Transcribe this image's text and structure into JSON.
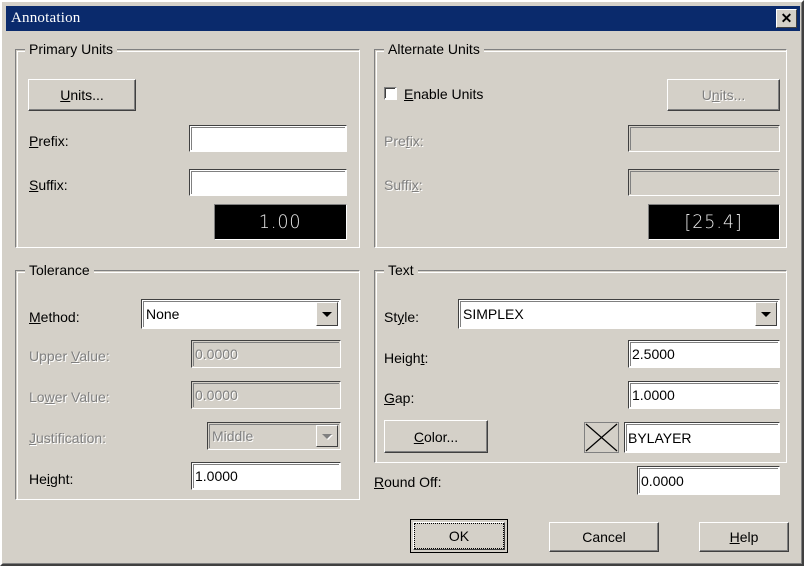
{
  "window": {
    "title": "Annotation",
    "close_label": "✕",
    "close_icon": "close-icon"
  },
  "primary_units": {
    "group_title": "Primary Units",
    "units_button": {
      "label": "Units...",
      "accel": "U"
    },
    "prefix": {
      "label": "Prefix:",
      "accel": "P",
      "value": ""
    },
    "suffix": {
      "label": "Suffix:",
      "accel": "S",
      "value": ""
    },
    "preview": "1.00"
  },
  "alternate_units": {
    "group_title": "Alternate Units",
    "enable": {
      "label": "Enable Units",
      "accel": "E",
      "checked": false
    },
    "units_button": {
      "label": "Units...",
      "accel": "n",
      "disabled": true
    },
    "prefix": {
      "label": "Prefix:",
      "accel": "f",
      "value": "",
      "disabled": true
    },
    "suffix": {
      "label": "Suffix:",
      "accel": "x",
      "value": "",
      "disabled": true
    },
    "preview": "[25.4]"
  },
  "tolerance": {
    "group_title": "Tolerance",
    "method": {
      "label": "Method:",
      "accel": "M",
      "value": "None"
    },
    "upper_value": {
      "label": "Upper Value:",
      "accel": "V",
      "value": "0.0000",
      "disabled": true
    },
    "lower_value": {
      "label": "Lower Value:",
      "accel": "w",
      "value": "0.0000",
      "disabled": true
    },
    "justification": {
      "label": "Justification:",
      "accel": "J",
      "value": "Middle",
      "disabled": true
    },
    "height": {
      "label": "Height:",
      "accel": "i",
      "value": "1.0000"
    }
  },
  "text": {
    "group_title": "Text",
    "style": {
      "label": "Style:",
      "accel": "y",
      "value": "SIMPLEX"
    },
    "height": {
      "label": "Height:",
      "accel": "t",
      "value": "2.5000"
    },
    "gap": {
      "label": "Gap:",
      "accel": "G",
      "value": "1.0000"
    },
    "color_button": {
      "label": "Color...",
      "accel": "C"
    },
    "color_value": "BYLAYER",
    "color_swatch_icon": "color-none-x-icon"
  },
  "round_off": {
    "label": "Round Off:",
    "accel": "R",
    "value": "0.0000"
  },
  "buttons": {
    "ok": {
      "label": "OK",
      "default": true
    },
    "cancel": {
      "label": "Cancel"
    },
    "help": {
      "label": "Help",
      "accel": "H"
    }
  },
  "colors": {
    "dialog_face": "#d4d0c8",
    "titlebar": "#0a2a6c",
    "titlebar_text": "#ffffff",
    "disabled_text": "#808080",
    "field_background": "#ffffff",
    "preview_background": "#000000",
    "preview_text": "#e8e8e8"
  }
}
